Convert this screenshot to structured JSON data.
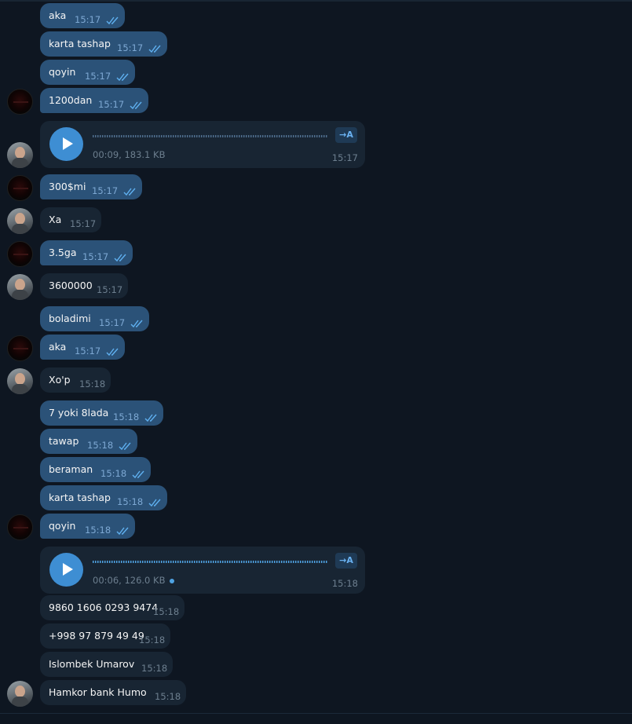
{
  "messages": [
    {
      "text": "aka",
      "time": "15:17"
    },
    {
      "text": "karta tashap",
      "time": "15:17"
    },
    {
      "text": "qoyin",
      "time": "15:17"
    },
    {
      "text": "1200dan",
      "time": "15:17"
    },
    {
      "text": "300$mi",
      "time": "15:17"
    },
    {
      "text": "Xa",
      "time": "15:17"
    },
    {
      "text": "3.5ga",
      "time": "15:17"
    },
    {
      "text": "3600000",
      "time": "15:17"
    },
    {
      "text": "boladimi",
      "time": "15:17"
    },
    {
      "text": "aka",
      "time": "15:17"
    },
    {
      "text": "Xo'p",
      "time": "15:18"
    },
    {
      "text": "7 yoki 8lada",
      "time": "15:18"
    },
    {
      "text": "tawap",
      "time": "15:18"
    },
    {
      "text": "beraman",
      "time": "15:18"
    },
    {
      "text": "karta tashap",
      "time": "15:18"
    },
    {
      "text": "qoyin",
      "time": "15:18"
    },
    {
      "text": "9860 1606 0293 9474",
      "time": "15:18"
    },
    {
      "text": "+998 97 879 49 49",
      "time": "15:18"
    },
    {
      "text": "Islombek Umarov",
      "time": "15:18"
    },
    {
      "text": "Hamkor bank Humo",
      "time": "15:18"
    }
  ],
  "voices": [
    {
      "meta": "00:09, 183.1 KB",
      "time": "15:17",
      "transcribe": "→A"
    },
    {
      "meta": "00:06, 126.0 KB",
      "time": "15:18",
      "transcribe": "→A"
    }
  ],
  "colors": {
    "background": "#0e1621",
    "outgoing": "#2b5278",
    "incoming": "#182533",
    "accent": "#3e8ed3"
  }
}
